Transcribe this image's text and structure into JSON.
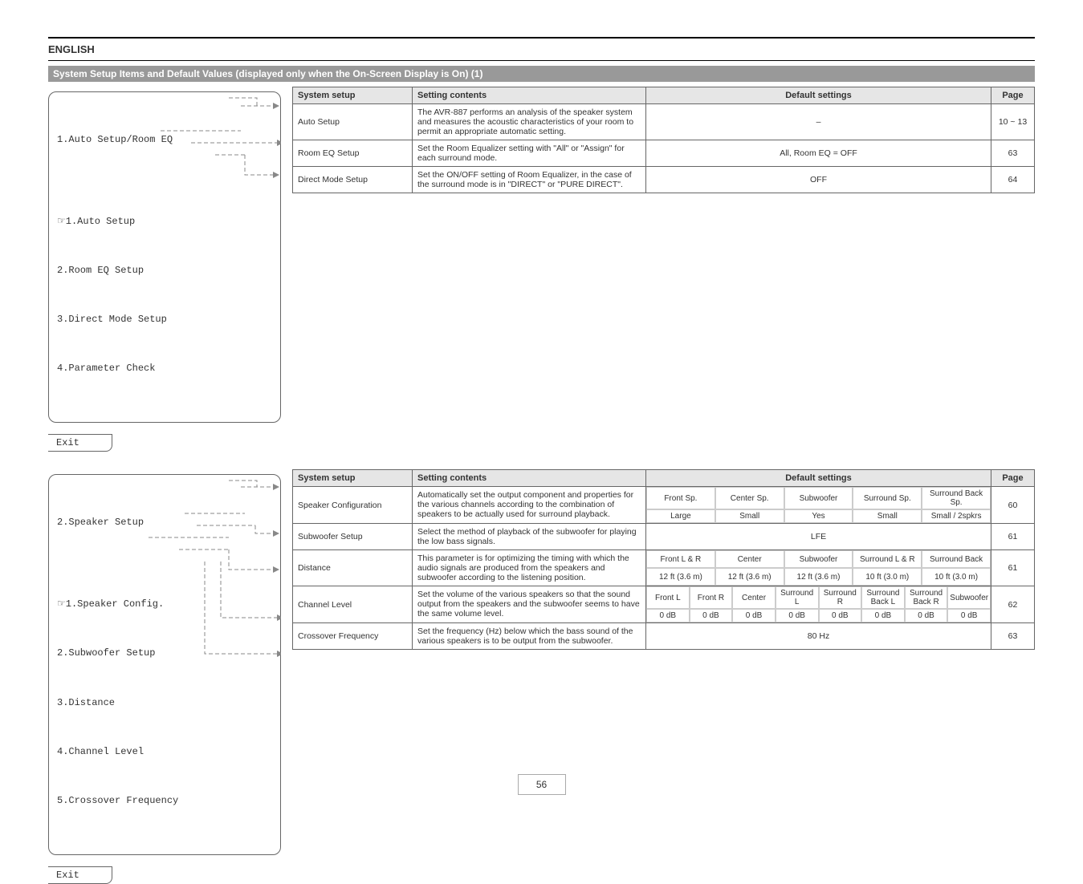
{
  "doc": {
    "heading_eng": "ENGLISH",
    "setup_main_title": "System Setup Items and Default Values (displayed only when the On-Screen Display is On) (1)"
  },
  "sec1": {
    "menu": {
      "title": "1.Auto Setup/Room EQ",
      "items": [
        "☞1.Auto Setup",
        "2.Room EQ Setup",
        "3.Direct Mode Setup",
        "4.Parameter Check"
      ],
      "exit": "Exit"
    },
    "headers": {
      "setup": "System setup",
      "content": "Setting contents",
      "default": "Default settings",
      "page": "Page"
    },
    "rows": [
      {
        "setup": "Auto Setup",
        "content": "The AVR-887 performs an analysis of the speaker system and measures the acoustic characteristics of your room to permit an appropriate automatic setting.",
        "default": "–",
        "page": "10 ~ 13"
      },
      {
        "setup": "Room EQ Setup",
        "content": "Set the Room Equalizer setting with \"All\" or \"Assign\" for each surround mode.",
        "default": "All, Room EQ = OFF",
        "page": "63"
      },
      {
        "setup": "Direct Mode Setup",
        "content": "Set the ON/OFF setting of Room Equalizer, in the case of the surround mode is in \"DIRECT\" or \"PURE DIRECT\".",
        "default": "OFF",
        "page": "64"
      }
    ]
  },
  "sec2": {
    "menu": {
      "title": "2.Speaker Setup",
      "items": [
        "☞1.Speaker Config.",
        "2.Subwoofer Setup",
        "3.Distance",
        "4.Channel Level",
        "5.Crossover Frequency"
      ],
      "exit": "Exit"
    },
    "headers": {
      "setup": "System setup",
      "content": "Setting contents",
      "default": "Default settings",
      "page": "Page"
    },
    "rows": [
      {
        "setup": "Speaker Configuration",
        "content": "Automatically set the output component and properties for the various channels according to the combination of speakers to be actually used for surround playback.",
        "page": "60",
        "default_top": [
          "Front Sp.",
          "Center Sp.",
          "Subwoofer",
          "Surround Sp.",
          "Surround Back Sp."
        ],
        "default_bot": [
          "Large",
          "Small",
          "Yes",
          "Small",
          "Small / 2spkrs"
        ]
      },
      {
        "setup": "Subwoofer Setup",
        "content": "Select the method of playback of the subwoofer for playing the low bass signals.",
        "page": "61",
        "default": "LFE"
      },
      {
        "setup": "Distance",
        "content": "This parameter is for optimizing the timing with which the audio signals are produced from the speakers and subwoofer according to the listening position.",
        "page": "61",
        "default_top": [
          "Front L & R",
          "Center",
          "Subwoofer",
          "Surround L & R",
          "Surround Back"
        ],
        "default_bot": [
          "12 ft (3.6 m)",
          "12 ft (3.6 m)",
          "12 ft (3.6 m)",
          "10 ft (3.0 m)",
          "10 ft (3.0 m)"
        ]
      },
      {
        "setup": "Channel Level",
        "content": "Set the volume of the various speakers so that the sound output from the speakers and the subwoofer seems to have the same volume level.",
        "page": "62",
        "default_top": [
          "Front L",
          "Front R",
          "Center",
          "Surround L",
          "Surround R",
          "Surround Back L",
          "Surround Back R",
          "Subwoofer"
        ],
        "default_bot": [
          "0 dB",
          "0 dB",
          "0 dB",
          "0 dB",
          "0 dB",
          "0 dB",
          "0 dB",
          "0 dB"
        ]
      },
      {
        "setup": "Crossover Frequency",
        "content": "Set the frequency (Hz) below which the bass sound of the various speakers is to be output from the subwoofer.",
        "page": "63",
        "default": "80 Hz"
      }
    ]
  },
  "pagenum": "56"
}
